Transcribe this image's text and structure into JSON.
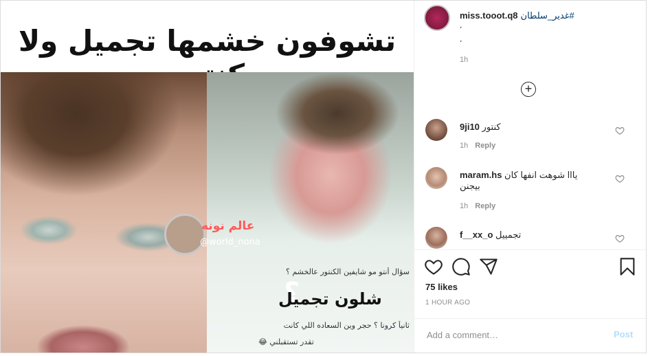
{
  "post_image": {
    "headline": "تشوفون خشمها تجميل ولا كنتور",
    "watermark_name": "عالم نونه",
    "watermark_handle": "@world_nona",
    "question_line": "سؤال أنتو مو شايفين الكنتور عالخشم ؟",
    "question_mark": "؟",
    "question_big": "شلون تجميل",
    "question_line2": "ثانياً كرونا ؟ حجر وين السعاده اللي كانت",
    "question_line3": "تقدر تستقبلني 😂"
  },
  "caption": {
    "username": "miss.tooot.q8",
    "hashtag": "#غدير_سلطان",
    "line2": "،",
    "line3": "،",
    "time": "1h"
  },
  "load_more_icon": "plus-circle-icon",
  "comments": [
    {
      "username": "9ji10",
      "text": "كنتور",
      "time": "1h",
      "reply": "Reply"
    },
    {
      "username": "maram.hs",
      "text": "يااا شوهت انفها كان",
      "text_cont": "بيجنن",
      "time": "1h",
      "reply": "Reply"
    },
    {
      "username": "f__xx_o",
      "text": "تجمييل"
    }
  ],
  "actions": {
    "like_icon": "heart-icon",
    "comment_icon": "comment-icon",
    "share_icon": "share-icon",
    "save_icon": "bookmark-icon"
  },
  "likes": "75 likes",
  "posted_ago": "1 HOUR AGO",
  "add_comment": {
    "placeholder": "Add a comment…",
    "post_label": "Post"
  },
  "colors": {
    "link": "#00376b",
    "muted": "#8e8e8e",
    "post_disabled": "#b2dffc"
  }
}
